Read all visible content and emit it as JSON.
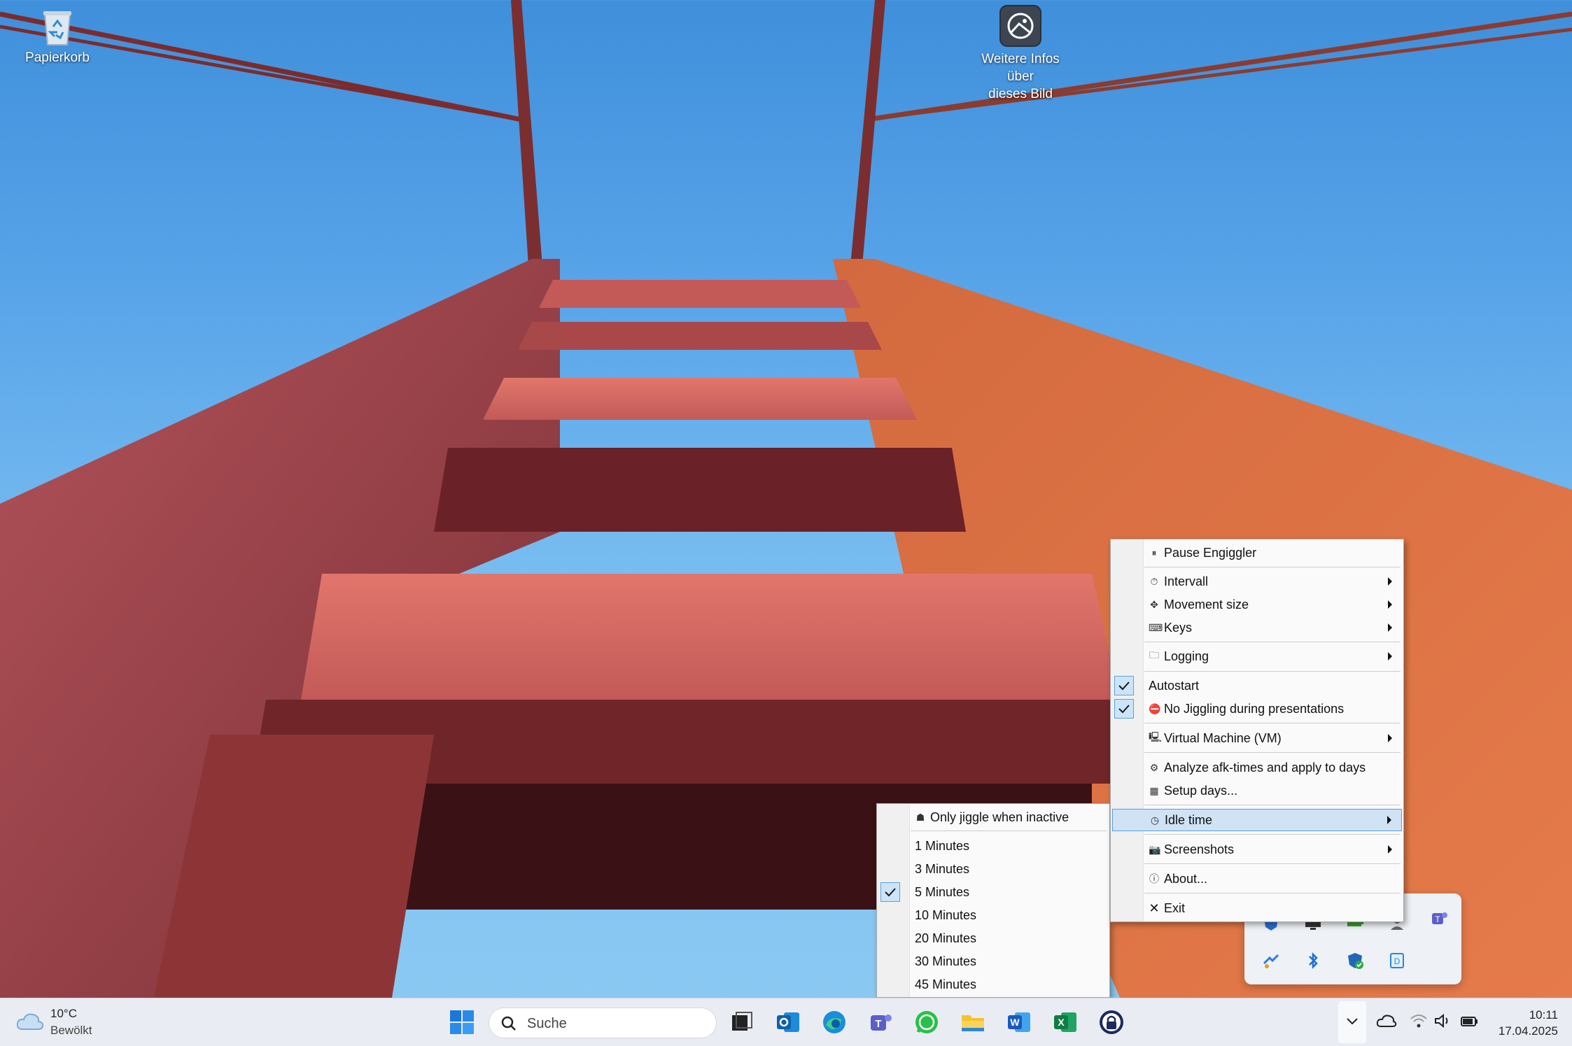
{
  "desktop": {
    "icons": [
      {
        "label": "Papierkorb"
      },
      {
        "label": "Weitere Infos über\ndieses Bild"
      }
    ]
  },
  "tray_menu": {
    "items": {
      "pause": "Pause Engiggler",
      "intervall": "Intervall",
      "movement": "Movement size",
      "keys": "Keys",
      "logging": "Logging",
      "autostart": "Autostart",
      "no_jiggling": "No Jiggling during presentations",
      "vm": "Virtual Machine (VM)",
      "analyze": "Analyze afk-times and apply to days",
      "setup": "Setup days...",
      "idle": "Idle time",
      "screenshots": "Screenshots",
      "about": "About...",
      "exit": "Exit"
    },
    "checked": [
      "Autostart",
      "No Jiggling during presentations"
    ],
    "highlighted": "Idle time"
  },
  "idle_submenu": {
    "items": {
      "only_inactive": "Only jiggle when inactive",
      "m1": "1 Minutes",
      "m3": "3 Minutes",
      "m5": "5 Minutes",
      "m10": "10 Minutes",
      "m20": "20 Minutes",
      "m30": "30 Minutes",
      "m45": "45 Minutes"
    },
    "selected": "5 Minutes"
  },
  "taskbar": {
    "weather": {
      "temp": "10°C",
      "condition": "Bewölkt"
    },
    "search_placeholder": "Suche",
    "apps": [
      "windows-start",
      "task-view",
      "outlook",
      "edge",
      "teams",
      "whatsapp",
      "file-explorer",
      "word",
      "excel",
      "keepass"
    ],
    "clock": {
      "time": "10:11",
      "date": "17.04.2025"
    }
  },
  "colors": {
    "menu_highlight": "#cfe3f5",
    "menu_highlight_border": "#5a9fd6",
    "taskbar": "#e9edf3"
  }
}
